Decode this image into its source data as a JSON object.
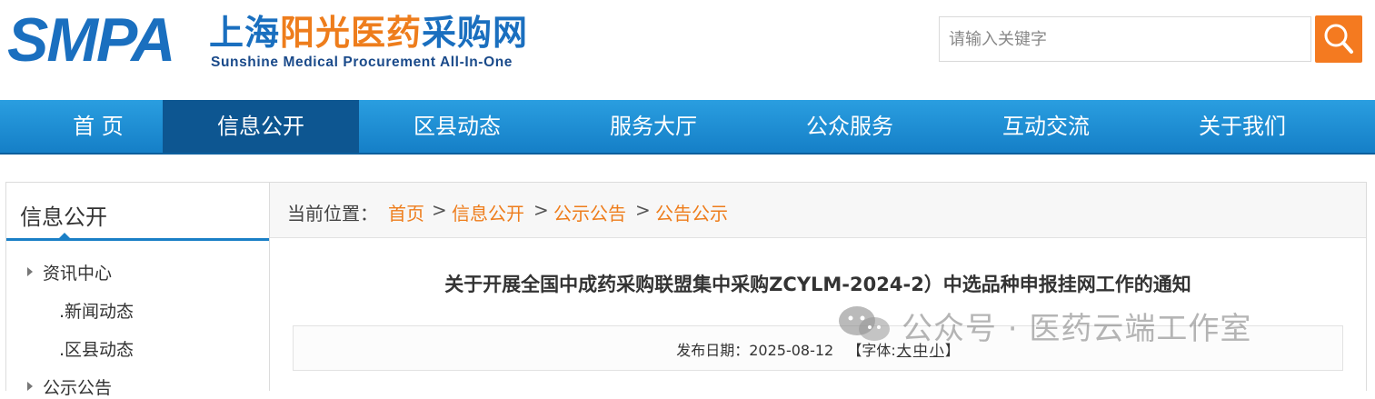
{
  "header": {
    "logo_abbr": "SMPA",
    "logo_cn_1": "上海",
    "logo_cn_2": "阳光医药",
    "logo_cn_3": "采购网",
    "logo_en": "Sunshine Medical Procurement All-In-One",
    "search_placeholder": "请输入关键字",
    "search_icon": "search-icon"
  },
  "colors": {
    "brand_blue": "#1a6fbf",
    "accent_orange": "#f47a20",
    "nav_blue": "#2a9ee0",
    "nav_active": "#0d5691",
    "link_orange": "#ee7d1c"
  },
  "nav": {
    "items": [
      {
        "label": "首 页"
      },
      {
        "label": "信息公开"
      },
      {
        "label": "区县动态"
      },
      {
        "label": "服务大厅"
      },
      {
        "label": "公众服务"
      },
      {
        "label": "互动交流"
      },
      {
        "label": "关于我们"
      }
    ],
    "active_index": 1
  },
  "sidebar": {
    "title": "信息公开",
    "items": [
      {
        "label": "资讯中心"
      },
      {
        "label": ".新闻动态"
      },
      {
        "label": ".区县动态"
      },
      {
        "label": "公示公告"
      }
    ]
  },
  "breadcrumb": {
    "label": "当前位置：",
    "items": [
      "首页",
      "信息公开",
      "公示公告",
      "公告公示"
    ],
    "separator": ">"
  },
  "article": {
    "title": "关于开展全国中成药采购联盟集中采购ZCYLM-2024-2）中选品种申报挂网工作的通知",
    "date_label": "发布日期：",
    "date": "2025-08-12",
    "font_label_open": "【字体:",
    "font_large": "大",
    "font_medium": "中",
    "font_small": "小",
    "font_label_close": "】"
  },
  "watermark": {
    "text": "公众号 · 医药云端工作室",
    "icon": "wechat-icon"
  }
}
